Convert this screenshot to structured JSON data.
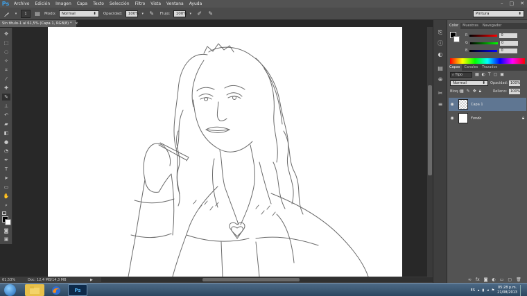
{
  "app": {
    "logo": "Ps"
  },
  "menu": [
    "Archivo",
    "Edición",
    "Imagen",
    "Capa",
    "Texto",
    "Selección",
    "Filtro",
    "Vista",
    "Ventana",
    "Ayuda"
  ],
  "window_controls": {
    "minimize": "–",
    "maximize": "□",
    "close": "✕"
  },
  "options_bar": {
    "brush_size": "1",
    "mode_label": "Modo:",
    "mode_value": "Normal",
    "opacity_label": "Opacidad:",
    "opacity_value": "100%",
    "flow_label": "Flujo:",
    "flow_value": "100%",
    "workspace": "Pintura"
  },
  "document": {
    "tab_title": "Sin título-1 al 61,5% (Capa 1, RGB/8) *",
    "tab_close": "×",
    "zoom": "61,53%",
    "doc_info": "Doc: 12,4 MB/14,3 MB"
  },
  "color_panel": {
    "tabs": [
      "Color",
      "Muestras",
      "Navegador"
    ],
    "channels": [
      {
        "label": "R",
        "value": "0",
        "color": "#e03030"
      },
      {
        "label": "G",
        "value": "0",
        "color": "#30b030"
      },
      {
        "label": "B",
        "value": "0",
        "color": "#3050e0"
      }
    ]
  },
  "layers_panel": {
    "tabs": [
      "Capas",
      "Canales",
      "Trazados"
    ],
    "filter": "Tipo",
    "blend_mode": "Normal",
    "opacity_label": "Opacidad:",
    "opacity_value": "100%",
    "lock_label": "Bloq.:",
    "fill_label": "Relleno:",
    "fill_value": "100%",
    "layers": [
      {
        "name": "Capa 1",
        "selected": true
      },
      {
        "name": "Fondo",
        "selected": false
      }
    ],
    "footer_icons": [
      "link-icon",
      "fx-icon",
      "mask-icon",
      "adjustment-icon",
      "folder-icon",
      "new-layer-icon",
      "trash-icon"
    ]
  },
  "taskbar": {
    "apps": [
      "explorer",
      "firefox",
      "photoshop"
    ],
    "photoshop_label": "Ps",
    "language": "ES",
    "time": "05:28 p.m.",
    "date": "21/08/2013"
  },
  "colors": {
    "panel_bg": "#535353",
    "workspace_bg": "#282828",
    "selected_layer": "#5f7692",
    "ps_blue": "#3da0e8"
  }
}
